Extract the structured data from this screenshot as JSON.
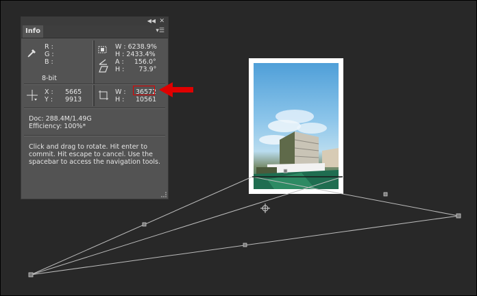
{
  "panel": {
    "tab_label": "Info",
    "rgb": {
      "r_label": "R :",
      "g_label": "G :",
      "b_label": "B :"
    },
    "bit_depth": "8-bit",
    "transform": {
      "w": "W : 6238.9%",
      "h": "H : 2433.4%",
      "a": "A :     156.0°",
      "skew": "H :       73.9°"
    },
    "position": {
      "x_label": "X :",
      "x_value": "5665",
      "y_label": "Y :",
      "y_value": "9913"
    },
    "size": {
      "w_label": "W :",
      "w_value": "36572",
      "h_label": "H :",
      "h_value": "10561"
    },
    "doc": "Doc: 288.4M/1.49G",
    "efficiency": "Efficiency: 100%*",
    "help_text": "Click and drag to rotate. Hit enter to\ncommit. Hit escape to cancel. Use the\nspacebar to access the navigation tools."
  },
  "colors": {
    "highlight": "#e00000",
    "panel_bg": "#535353",
    "canvas_bg": "#282828"
  }
}
